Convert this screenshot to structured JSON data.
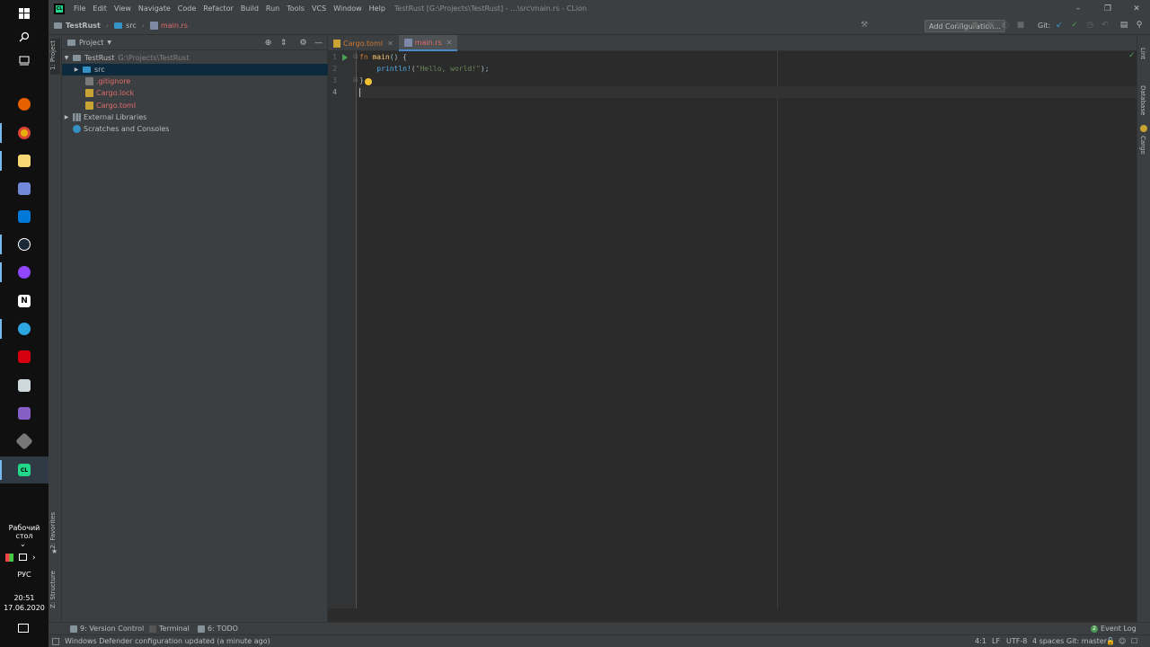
{
  "taskbar": {
    "desktop_label": "Рабочий стол",
    "language": "РУС",
    "time": "20:51",
    "date": "17.06.2020"
  },
  "titlebar": {
    "logo_text": "CL",
    "menu": [
      "File",
      "Edit",
      "View",
      "Navigate",
      "Code",
      "Refactor",
      "Build",
      "Run",
      "Tools",
      "VCS",
      "Window",
      "Help"
    ],
    "window_title": "TestRust [G:\\Projects\\TestRust] - ...\\src\\main.rs - CLion"
  },
  "navbar": {
    "project": "TestRust",
    "folder": "src",
    "file": "main.rs",
    "add_configuration": "Add Configuration...",
    "git_label": "Git:"
  },
  "left_strip": {
    "project_tab": "1: Project",
    "favorites_tab": "2: Favorites",
    "structure_tab": "Z: Structure"
  },
  "project_panel": {
    "title": "Project",
    "root_name": "TestRust",
    "root_path": "G:\\Projects\\TestRust",
    "items": [
      {
        "label": "src"
      },
      {
        "label": ".gitignore"
      },
      {
        "label": "Cargo.lock"
      },
      {
        "label": "Cargo.toml"
      },
      {
        "label": "External Libraries"
      },
      {
        "label": "Scratches and Consoles"
      }
    ]
  },
  "editor": {
    "tabs": [
      {
        "label": "Cargo.toml"
      },
      {
        "label": "main.rs"
      }
    ],
    "line_numbers": [
      "1",
      "2",
      "3",
      "4"
    ],
    "code": {
      "line1_kw": "fn",
      "line1_name": "main",
      "line1_rest": "() {",
      "line2_indent": "    ",
      "line2_macro": "println!",
      "line2_open": "(",
      "line2_str": "\"Hello, world!\"",
      "line2_close": ");",
      "line3": "}"
    }
  },
  "right_strip": {
    "lint": "Lint",
    "database": "Database",
    "cargo": "Cargo"
  },
  "bottom_tools": {
    "version_control": "9: Version Control",
    "terminal": "Terminal",
    "todo": "6: TODO",
    "event_log_count": "2",
    "event_log": "Event Log"
  },
  "statusbar": {
    "message": "Windows Defender configuration updated (a minute ago)",
    "position": "4:1",
    "line_sep": "LF",
    "encoding": "UTF-8",
    "indent": "4 spaces",
    "git": "Git: master"
  }
}
